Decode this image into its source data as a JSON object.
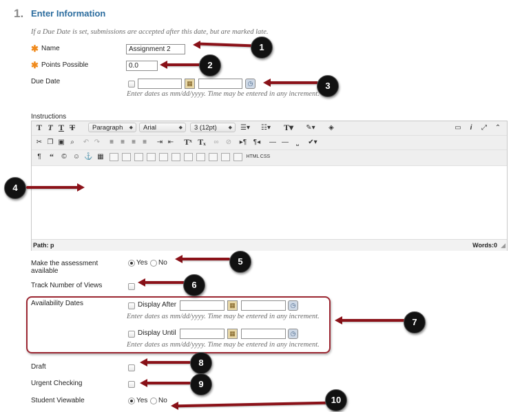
{
  "section": {
    "number": "1.",
    "title": "Enter Information"
  },
  "due_note": "If a Due Date is set, submissions are accepted after this date, but are marked late.",
  "fields": {
    "name": {
      "label": "Name",
      "required_mark": "✱",
      "value": "Assignment 2"
    },
    "points": {
      "label": "Points Possible",
      "required_mark": "✱",
      "value": "0.0"
    },
    "due_date": {
      "label": "Due Date",
      "date_hint": "Enter dates as mm/dd/yyyy. Time may be entered in any increment."
    },
    "instructions": {
      "label": "Instructions"
    }
  },
  "editor": {
    "format_dropdown": "Paragraph",
    "font_dropdown": "Arial",
    "size_dropdown": "3 (12pt)",
    "path": "Path: p",
    "word_count": "Words:0",
    "html_button": "HTML",
    "css_button": "CSS"
  },
  "available": {
    "label": "Make the assessment available",
    "yes": "Yes",
    "no": "No",
    "selected": "Yes"
  },
  "track_views": {
    "label": "Track Number of Views"
  },
  "availability_dates": {
    "label": "Availability Dates",
    "display_after": "Display After",
    "display_until": "Display Until",
    "hint": "Enter dates as mm/dd/yyyy. Time may be entered in any increment."
  },
  "draft": {
    "label": "Draft"
  },
  "urgent": {
    "label": "Urgent Checking"
  },
  "student_viewable": {
    "label": "Student Viewable",
    "yes": "Yes",
    "no": "No",
    "selected": "Yes"
  },
  "callouts": [
    "1",
    "2",
    "3",
    "4",
    "5",
    "6",
    "7",
    "8",
    "9",
    "10"
  ],
  "colors": {
    "accent": "#2b6c9e",
    "required": "#f08a1c",
    "arrow": "#8b1219"
  }
}
